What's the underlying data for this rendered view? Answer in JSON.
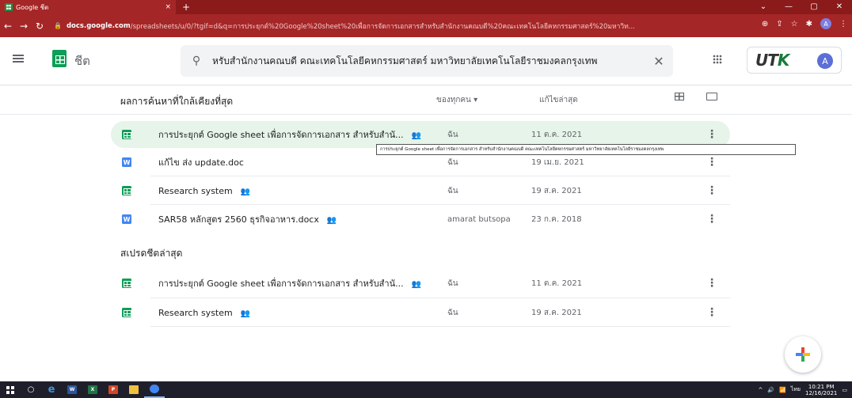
{
  "browser": {
    "tab_title": "Google ชีต",
    "tab_close": "×",
    "new_tab": "+",
    "win_min": "—",
    "win_max": "▢",
    "win_close": "✕",
    "url_host": "docs.google.com",
    "url_path": "/spreadsheets/u/0/?tgif=d&q=การประยุกต์%20Google%20sheet%20เพื่อการจัดการเอกสารสำหรับสำนักงานคณบดี%20คณะเทคโนโลยีคหกรรมศาสตร์%20มหาวิท...",
    "profile_initial": "A"
  },
  "header": {
    "app_name": "ชีต",
    "search_value": "หรับสำนักงานคณบดี คณะเทคโนโลยีคหกรรมศาสตร์ มหาวิทยาลัยเทคโนโลยีราชมงคลกรุงเทพ",
    "brand_text_1": "UT",
    "brand_text_2": "K",
    "avatar_initial": "A"
  },
  "results": {
    "heading": "ผลการค้นหาที่ใกล้เคียงที่สุด",
    "owner_filter": "ของทุกคน ▾",
    "modified_label": "แก้ไขล่าสุด",
    "rows": [
      {
        "name": "การประยุกต์ Google sheet เพื่อการจัดการเอกสาร สำหรับสำนั...",
        "shared": "👥",
        "owner": "ฉัน",
        "date": "11 ต.ค. 2021"
      },
      {
        "name": "แก้ไข ส่ง update.doc",
        "shared": "",
        "owner": "ฉัน",
        "date": "19 เม.ย. 2021"
      },
      {
        "name": "Research system",
        "shared": "👥",
        "owner": "ฉัน",
        "date": "19 ส.ค. 2021"
      },
      {
        "name": "SAR58 หลักสูตร 2560 ธุรกิจอาหาร.docx",
        "shared": "👥",
        "owner": "amarat butsopa",
        "date": "23 ก.ค. 2018"
      }
    ],
    "tooltip": "การประยุกต์ Google sheet เพื่อการจัดการเอกสาร สำหรับสำนักงานคณบดี คณะเทคโนโลยีคหกรรมศาสตร์ มหาวิทยาลัยเทคโนโลยีราชมงคลกรุงเทพ"
  },
  "recent": {
    "heading": "สเปรดชีตล่าสุด",
    "rows": [
      {
        "name": "การประยุกต์ Google sheet เพื่อการจัดการเอกสาร สำหรับสำนั...",
        "shared": "👥",
        "owner": "ฉัน",
        "date": "11 ต.ค. 2021"
      },
      {
        "name": "Research system",
        "shared": "👥",
        "owner": "ฉัน",
        "date": "19 ส.ค. 2021"
      }
    ]
  },
  "taskbar": {
    "lang": "ไทย",
    "time": "10:21 PM",
    "date": "12/16/2021"
  },
  "colors": {
    "browser_frame": "#a52626",
    "sheets_green": "#0f9d58",
    "doc_blue": "#4285f4",
    "highlight_row": "#e6f4ea"
  }
}
